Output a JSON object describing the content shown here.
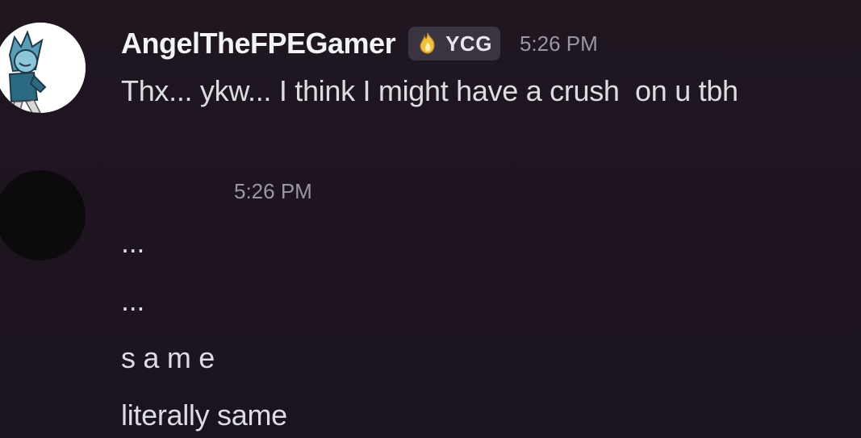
{
  "messages": [
    {
      "username": "AngelTheFPEGamer",
      "tag": {
        "label": "YCG",
        "icon": "flame-icon"
      },
      "timestamp": "5:26 PM",
      "lines": [
        "Thx... ykw... I think I might have a crush  on u tbh"
      ]
    },
    {
      "username": "",
      "timestamp": "5:26 PM",
      "lines": [
        "...",
        "...",
        "s a m e",
        "literally same"
      ]
    }
  ],
  "colors": {
    "background": "#1e1520",
    "username": "#f2f3f5",
    "message_text": "#dcdde1",
    "timestamp": "#9a97a2",
    "tag_background": "#3a3340",
    "tag_icon": "#f0c040"
  }
}
